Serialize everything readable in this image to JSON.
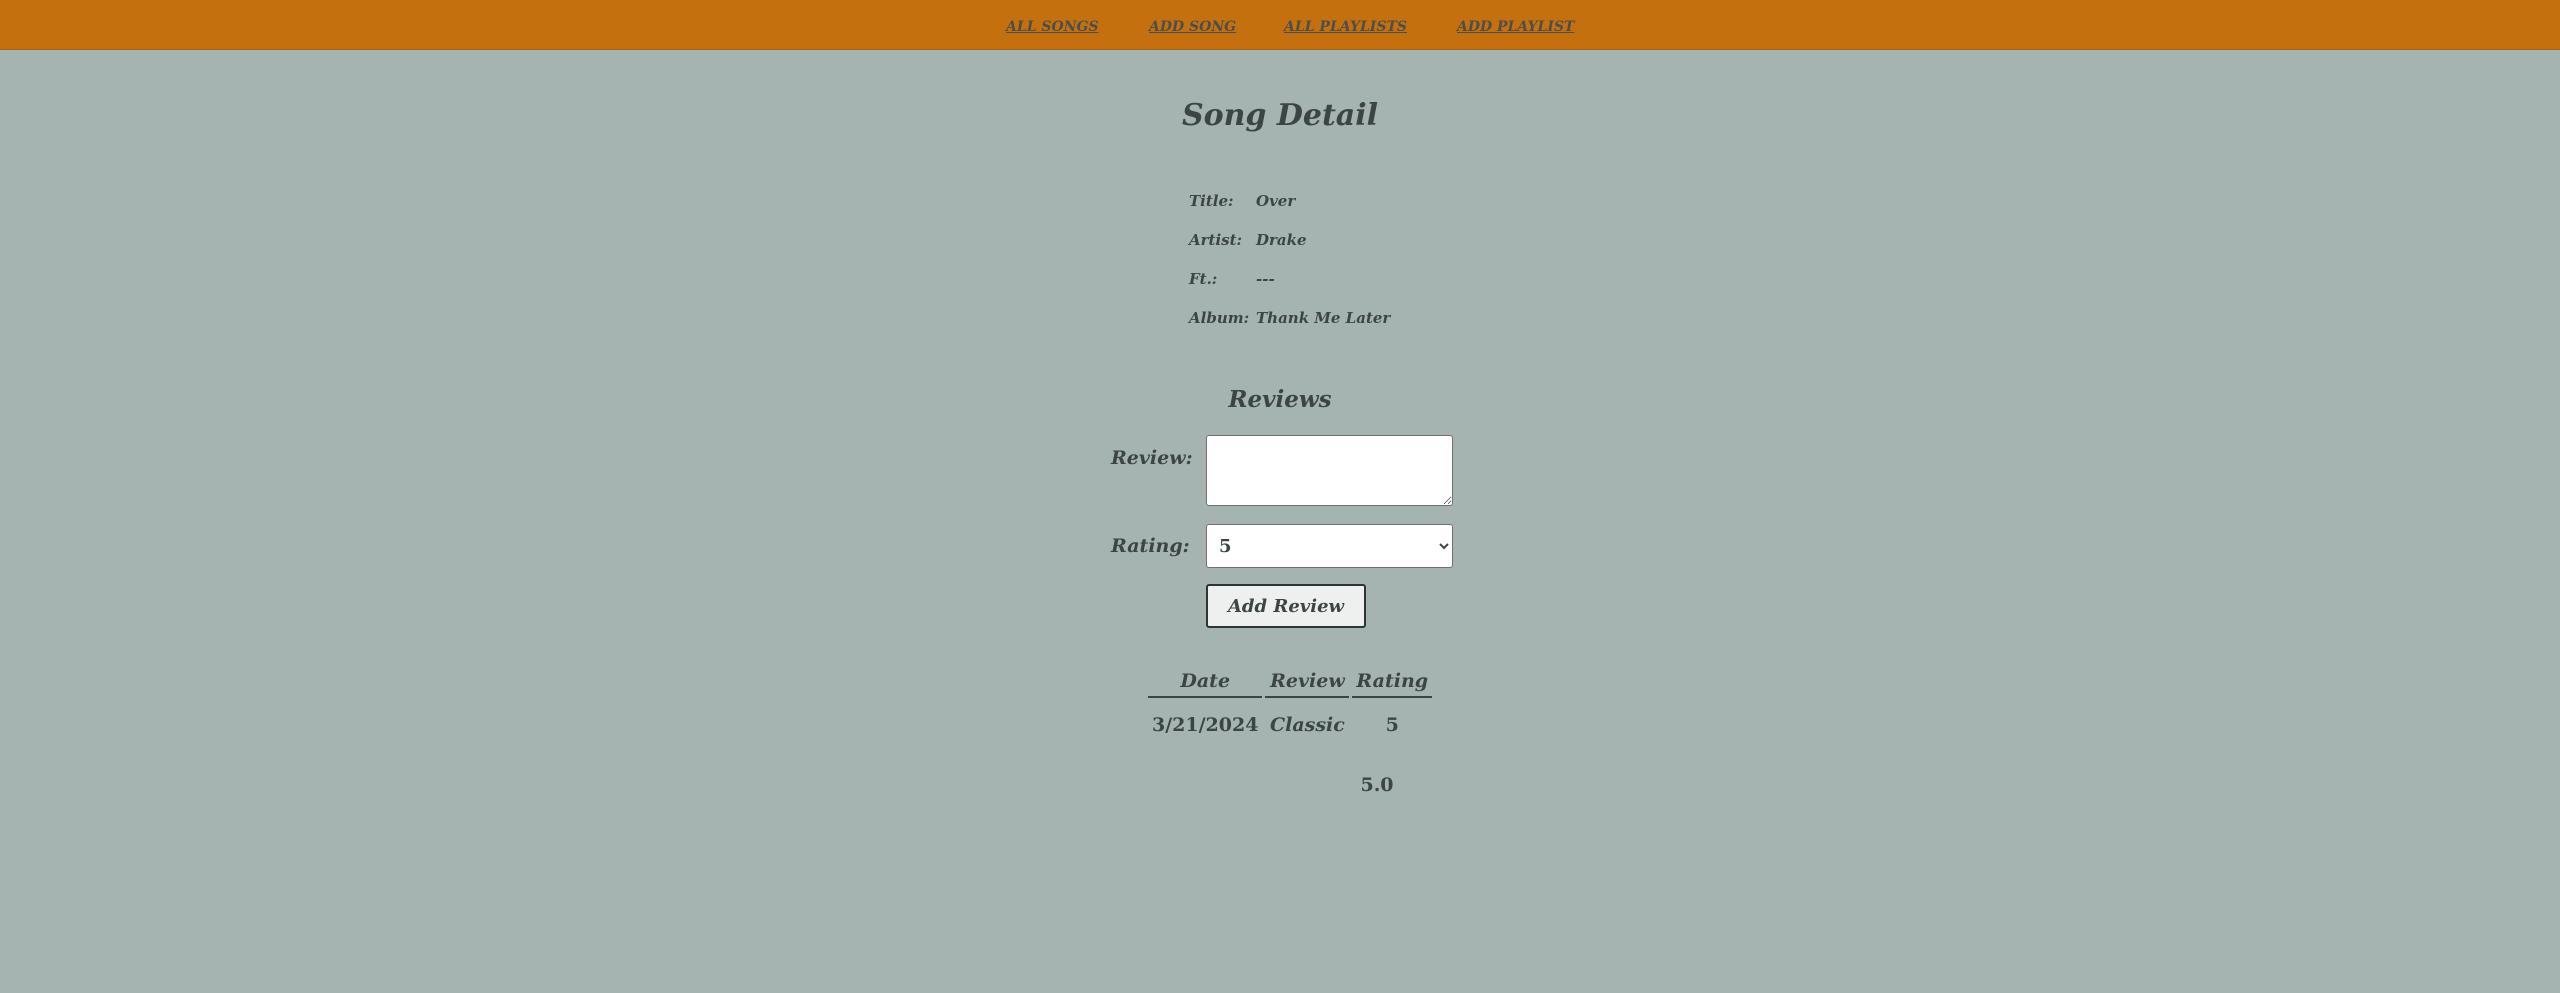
{
  "nav": {
    "items": [
      "ALL SONGS",
      "ADD SONG",
      "ALL PLAYLISTS",
      "ADD PLAYLIST"
    ]
  },
  "page_title": "Song Detail",
  "song": {
    "title_label": "Title:",
    "title_value": "Over",
    "artist_label": "Artist:",
    "artist_value": "Drake",
    "ft_label": "Ft.:",
    "ft_value": "---",
    "album_label": "Album:",
    "album_value": "Thank Me Later"
  },
  "reviews": {
    "section_title": "Reviews",
    "review_label": "Review:",
    "review_value": "",
    "rating_label": "Rating:",
    "rating_selected": "5",
    "add_button_label": "Add Review",
    "table": {
      "headers": [
        "Date",
        "Review",
        "Rating"
      ],
      "rows": [
        [
          "3/21/2024",
          "Classic",
          "5"
        ]
      ]
    },
    "average_rating": "5.0"
  },
  "colors": {
    "navbar": "#c4700f",
    "background": "#a5b4b0",
    "text": "#3d4544"
  }
}
